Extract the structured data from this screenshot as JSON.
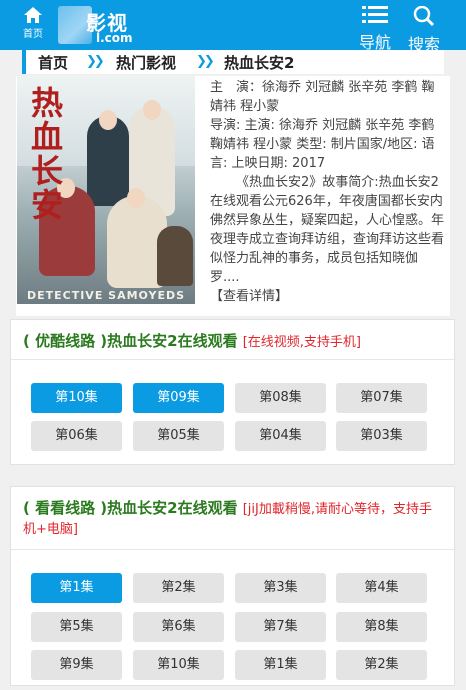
{
  "header": {
    "home_label": "首页",
    "logo_text": "影视",
    "logo_sub": "l.com",
    "nav_label": "导航",
    "search_label": "搜索",
    "accent": "#0a9be3"
  },
  "breadcrumb": {
    "home": "首页",
    "sep": "»",
    "category": "热门影视",
    "current": "热血长安2"
  },
  "movie": {
    "poster_title": "热血长安",
    "poster_tagline": "DETECTIVE SAMOYEDS",
    "meta_line1": "主　演：徐海乔 刘冠麟 张辛苑 李鹤 鞠婧祎 程小蒙",
    "meta_line2": "导演: 主演: 徐海乔 刘冠麟 张辛苑 李鹤 鞠婧祎 程小蒙 类型: 制片国家/地区: 语言: 上映日期: 2017",
    "synopsis": "《热血长安2》故事简介:热血长安2在线观看公元626年，年夜唐国都长安内佛然异象丛生，疑案四起，人心惶惑。年夜理寺成立查询拜访组，查询拜访这些看似怪力乱神的事务，成员包括知晓伽罗....",
    "detail_link": "【查看详情】"
  },
  "sections": [
    {
      "title": "( 优酷线路 )热血长安2在线观看",
      "note": "[在线视频,支持手机]",
      "episodes": [
        "第10集",
        "第09集",
        "第08集",
        "第07集",
        "第06集",
        "第05集",
        "第04集",
        "第03集"
      ],
      "active": [
        0,
        1
      ]
    },
    {
      "title": "( 看看线路 )热血长安2在线观看",
      "note": "[jiJ加載稍慢,请耐心等待，支持手机+电脑]",
      "episodes": [
        "第1集",
        "第2集",
        "第3集",
        "第4集",
        "第5集",
        "第6集",
        "第7集",
        "第8集",
        "第9集",
        "第10集",
        "第1集",
        "第2集"
      ],
      "active": [
        0
      ]
    }
  ],
  "colors": {
    "active_button": "#0a9be3",
    "inactive_button": "#e4e4e4",
    "section_title": "#2b7a1f",
    "note_red": "#e0262c"
  }
}
